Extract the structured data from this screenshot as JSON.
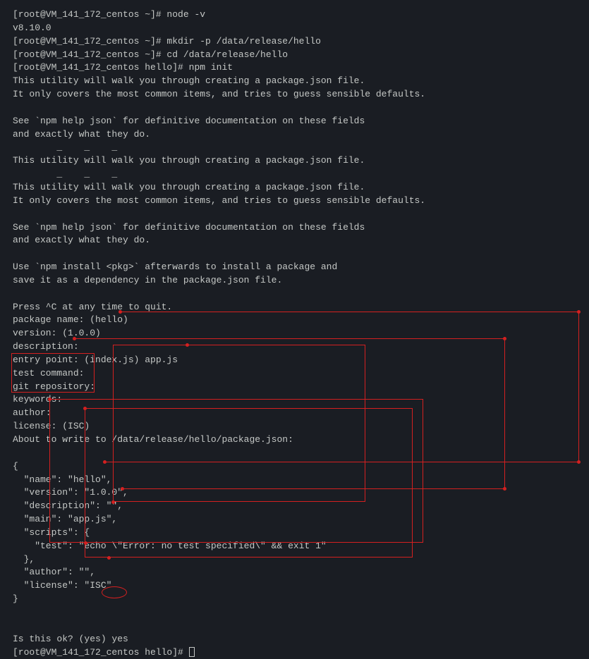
{
  "lines": {
    "l1": "[root@VM_141_172_centos ~]# node -v",
    "l2": "v8.10.0",
    "l3": "[root@VM_141_172_centos ~]# mkdir -p /data/release/hello",
    "l4": "[root@VM_141_172_centos ~]# cd /data/release/hello",
    "l5": "[root@VM_141_172_centos hello]# npm init",
    "l6": "This utility will walk you through creating a package.json file.",
    "l7": "It only covers the most common items, and tries to guess sensible defaults.",
    "l8": "",
    "l9": "See `npm help json` for definitive documentation on these fields",
    "l10": "and exactly what they do.",
    "l11": "        _    _    _",
    "l12": "This utility will walk you through creating a package.json file.",
    "l13": "        _    _    _",
    "l14": "This utility will walk you through creating a package.json file.",
    "l15": "It only covers the most common items, and tries to guess sensible defaults.",
    "l16": "",
    "l17": "See `npm help json` for definitive documentation on these fields",
    "l18": "and exactly what they do.",
    "l19": "",
    "l20": "Use `npm install <pkg>` afterwards to install a package and",
    "l21": "save it as a dependency in the package.json file.",
    "l22": "",
    "l23": "Press ^C at any time to quit.",
    "l24": "package name: (hello)",
    "l25": "version: (1.0.0)",
    "l26": "description:",
    "l27": "entry point: (index.js) app.js",
    "l28": "test command:",
    "l29": "git repository:",
    "l30": "keywords:",
    "l31": "author:",
    "l32": "license: (ISC)",
    "l33": "About to write to /data/release/hello/package.json:",
    "l34": "",
    "l35": "{",
    "l36": "  \"name\": \"hello\",",
    "l37": "  \"version\": \"1.0.0\",",
    "l38": "  \"description\": \"\",",
    "l39": "  \"main\": \"app.js\",",
    "l40": "  \"scripts\": {",
    "l41": "    \"test\": \"echo \\\"Error: no test specified\\\" && exit 1\"",
    "l42": "  },",
    "l43": "  \"author\": \"\",",
    "l44": "  \"license\": \"ISC\"",
    "l45": "}",
    "l46": "",
    "l47": "",
    "l48": "Is this ok? (yes) yes",
    "l49": "[root@VM_141_172_centos hello]# "
  }
}
